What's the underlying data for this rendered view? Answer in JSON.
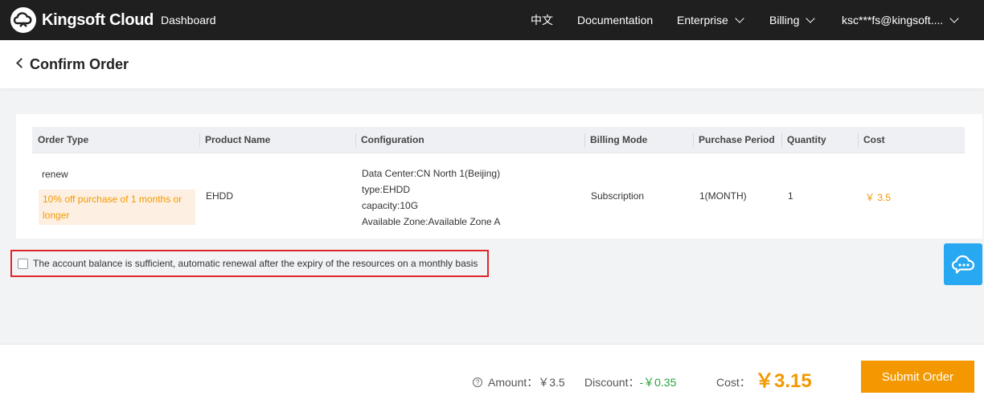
{
  "nav": {
    "brand": "Kingsoft Cloud",
    "dashboard": "Dashboard",
    "lang": "中文",
    "documentation": "Documentation",
    "enterprise": "Enterprise",
    "billing": "Billing",
    "account": "ksc***fs@kingsoft...."
  },
  "header": {
    "title": "Confirm Order"
  },
  "table": {
    "columns": [
      "Order Type",
      "Product Name",
      "Configuration",
      "Billing Mode",
      "Purchase Period",
      "Quantity",
      "Cost"
    ],
    "row": {
      "order_type": "renew",
      "promo": "10% off purchase of 1 months or longer",
      "product_name": "EHDD",
      "config": [
        "Data Center:CN North 1(Beijing)",
        "type:EHDD",
        "capacity:10G",
        "Available Zone:Available Zone A"
      ],
      "billing_mode": "Subscription",
      "period": "1(MONTH)",
      "quantity": "1",
      "cost": "￥ 3.5"
    }
  },
  "autorenew": {
    "checked": false,
    "label": "The account balance is sufficient, automatic renewal after the expiry of the resources on a monthly basis"
  },
  "footer": {
    "amount_label": "Amount：",
    "amount_value": "￥3.5",
    "discount_label": "Discount：",
    "discount_value": "-￥0.35",
    "cost_label": "Cost：",
    "cost_value": "￥3.15",
    "submit": "Submit Order"
  },
  "colors": {
    "accent": "#f39800",
    "nav_bg": "#1f1f1f",
    "highlight_border": "#e0262b",
    "discount": "#29a33c",
    "help": "#29a8f2"
  },
  "icons": {
    "brand": "cloud-logo-icon",
    "back": "chevron-left-icon",
    "dropdown": "chevron-down-icon",
    "help": "question-circle-icon",
    "support": "chat-bubble-icon"
  }
}
